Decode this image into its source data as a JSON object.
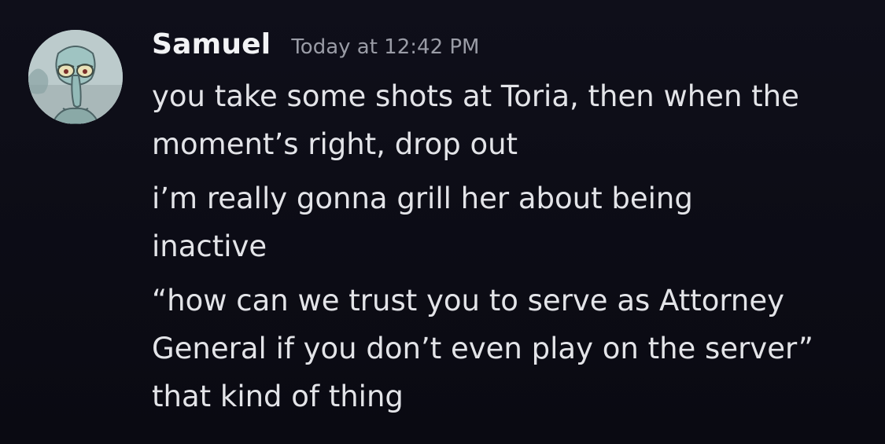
{
  "author": {
    "name": "Samuel",
    "avatar_icon": "squidward-avatar-icon"
  },
  "timestamp": "Today at 12:42 PM",
  "messages": [
    {
      "lines": [
        "you take some shots at Toria, then when the",
        "moment’s right, drop out"
      ]
    },
    {
      "lines": [
        "i’m really gonna grill her about being",
        "inactive"
      ]
    },
    {
      "lines": [
        "“how can we trust you to serve as Attorney",
        "General if you don’t even play on the server”",
        "that kind of thing"
      ]
    }
  ],
  "colors": {
    "background": "#0d0d17",
    "username": "#f2f3f5",
    "timestamp": "#9a9ca6",
    "message_text": "#e3e4e8"
  }
}
